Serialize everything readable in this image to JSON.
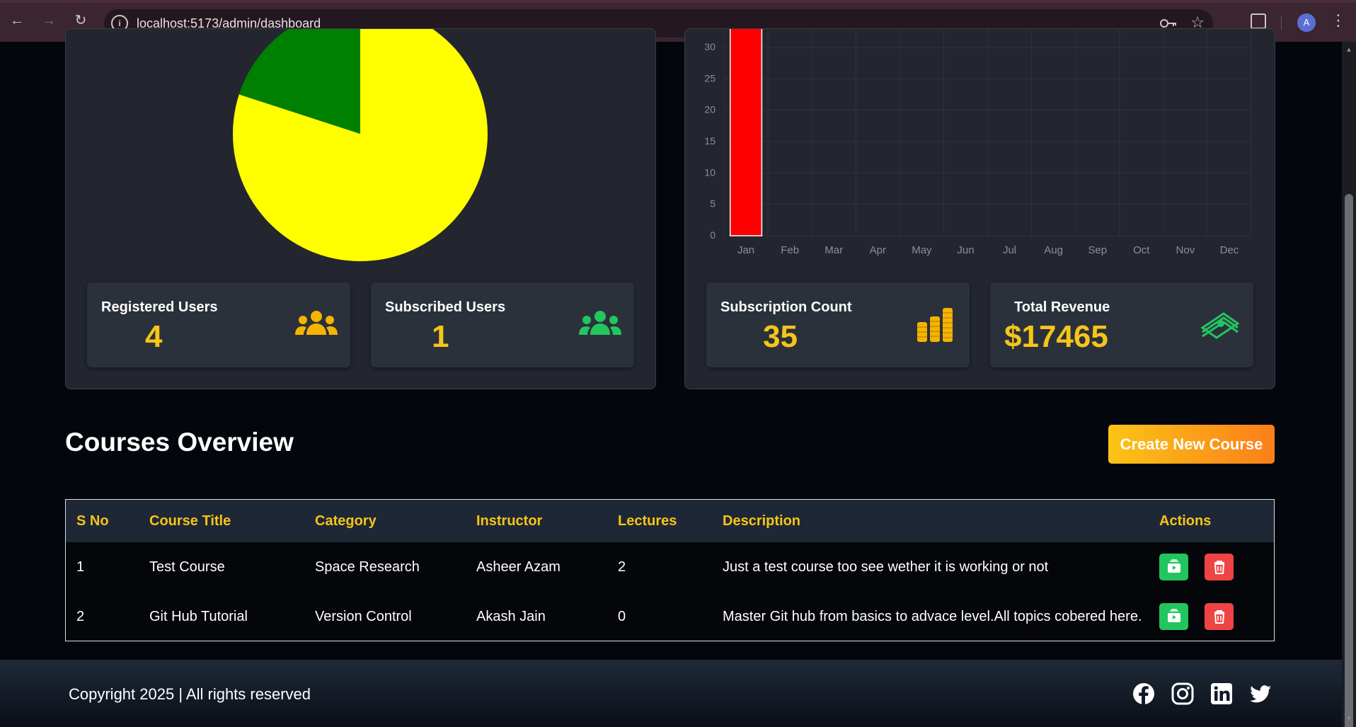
{
  "browser": {
    "url": "localhost:5173/admin/dashboard",
    "profile_initial": "A"
  },
  "left_panel": {
    "pie": {
      "slices": [
        {
          "value": 80,
          "color": "#ffff00"
        },
        {
          "value": 20,
          "color": "#008000"
        }
      ]
    },
    "cards": [
      {
        "label": "Registered Users",
        "value": "4",
        "icon": "users-icon",
        "icon_color": "#f5b400"
      },
      {
        "label": "Subscribed Users",
        "value": "1",
        "icon": "users-icon",
        "icon_color": "#22c55e"
      }
    ]
  },
  "right_panel": {
    "cards": [
      {
        "label": "Subscription Count",
        "value": "35",
        "icon": "coins-icon",
        "icon_color": "#f5b400"
      },
      {
        "label": "Total Revenue",
        "value": "$17465",
        "icon": "money-icon",
        "icon_color": "#22c55e"
      }
    ]
  },
  "chart_data": {
    "type": "bar",
    "categories": [
      "Jan",
      "Feb",
      "Mar",
      "Apr",
      "May",
      "Jun",
      "Jul",
      "Aug",
      "Sep",
      "Oct",
      "Nov",
      "Dec"
    ],
    "values": [
      35,
      0,
      0,
      0,
      0,
      0,
      0,
      0,
      0,
      0,
      0,
      0
    ],
    "y_ticks": [
      "0",
      "5",
      "10",
      "15",
      "20",
      "25",
      "30"
    ],
    "ylim": [
      0,
      30
    ],
    "bar_color": "#ff0000",
    "grid": true
  },
  "courses": {
    "title": "Courses Overview",
    "create_label": "Create New Course",
    "headers": [
      "S No",
      "Course Title",
      "Category",
      "Instructor",
      "Lectures",
      "Description",
      "Actions"
    ],
    "rows": [
      [
        "1",
        "Test Course",
        "Space Research",
        "Asheer Azam",
        "2",
        "Just a test course too see wether it is working or not"
      ],
      [
        "2",
        "Git Hub Tutorial",
        "Version Control",
        "Akash Jain",
        "0",
        "Master Git hub from basics to advace level.All topics cobered here."
      ]
    ]
  },
  "footer": {
    "copyright": "Copyright 2025 | All rights reserved",
    "social": [
      "facebook-icon",
      "instagram-icon",
      "linkedin-icon",
      "twitter-icon"
    ]
  }
}
